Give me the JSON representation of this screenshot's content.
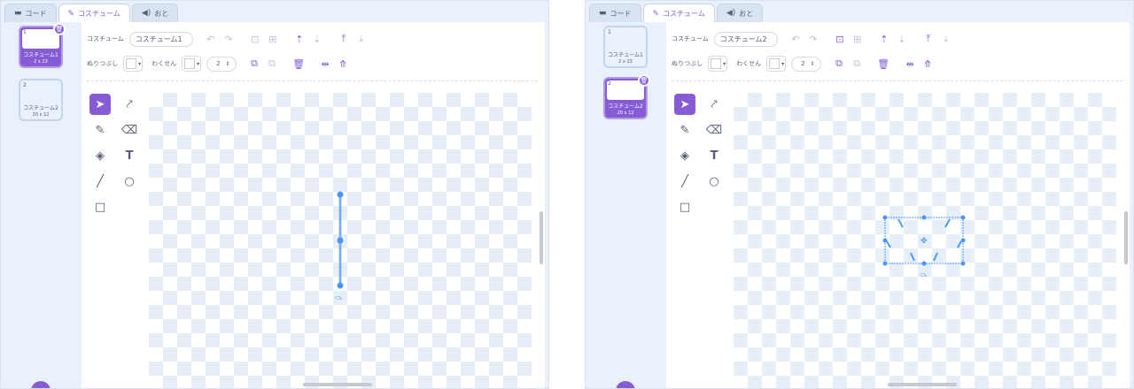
{
  "tabs": {
    "code": "コード",
    "costume": "コスチューム",
    "sound": "おと"
  },
  "labels": {
    "costume": "コスチューム",
    "fill": "ぬりつぶし",
    "outline": "わくせん"
  },
  "left": {
    "costume_name": "コスチューム1",
    "stroke_width": "2",
    "costumes": [
      {
        "num": "1",
        "name": "コスチューム1",
        "size": "2 x 23"
      },
      {
        "num": "2",
        "name": "コスチューム2",
        "size": "20 x 12"
      }
    ]
  },
  "right": {
    "costume_name": "コスチューム2",
    "stroke_width": "2",
    "costumes": [
      {
        "num": "1",
        "name": "コスチューム1",
        "size": "2 x 23"
      },
      {
        "num": "2",
        "name": "コスチューム2",
        "size": "20 x 12"
      }
    ]
  },
  "icons": {
    "code": "code-icon",
    "brush": "brush-icon",
    "sound": "speaker-icon",
    "undo": "undo-icon",
    "redo": "redo-icon",
    "group": "group-icon",
    "ungroup": "ungroup-icon",
    "forward": "forward-icon",
    "backward": "backward-icon",
    "front": "front-icon",
    "back": "back-icon",
    "copy": "copy-icon",
    "paste": "paste-icon",
    "delete": "trash-icon",
    "flip_h": "flip-horizontal-icon",
    "flip_v": "flip-vertical-icon"
  },
  "colors": {
    "accent": "#855cd6",
    "selection": "#4c97ff",
    "stroke": "#d9541e"
  }
}
